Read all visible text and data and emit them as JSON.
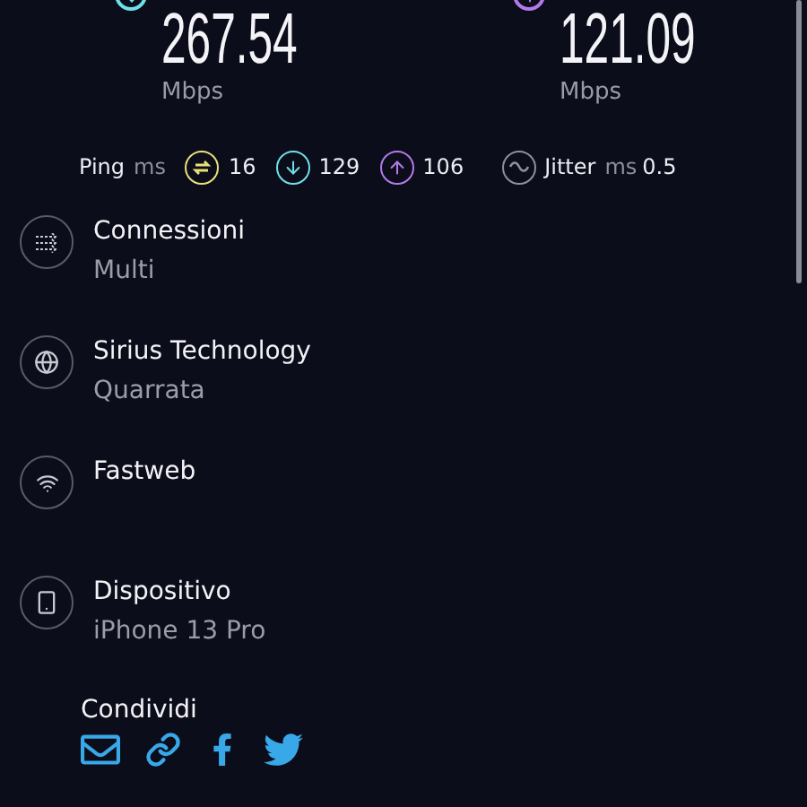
{
  "speeds": [
    {
      "kind": "download",
      "value": "267.54",
      "unit": "Mbps",
      "color": "#6fe0e8"
    },
    {
      "kind": "upload",
      "value": "121.09",
      "unit": "Mbps",
      "color": "#b47be8"
    }
  ],
  "ping": {
    "label": "Ping",
    "unit": "ms",
    "items": [
      {
        "kind": "idle",
        "value": "16",
        "color": "#e8e27a"
      },
      {
        "kind": "download",
        "value": "129",
        "color": "#6fe0e8"
      },
      {
        "kind": "upload",
        "value": "106",
        "color": "#b47be8"
      }
    ]
  },
  "jitter": {
    "label": "Jitter",
    "unit": "ms",
    "value": "0.5"
  },
  "details": [
    {
      "kind": "connections",
      "title": "Connessioni",
      "subtitle": "Multi"
    },
    {
      "kind": "server",
      "title": "Sirius Technology",
      "subtitle": "Quarrata"
    },
    {
      "kind": "provider",
      "title": "Fastweb"
    },
    {
      "kind": "device",
      "title": "Dispositivo",
      "subtitle": "iPhone 13 Pro"
    }
  ],
  "share": {
    "title": "Condividi",
    "items": [
      {
        "kind": "email"
      },
      {
        "kind": "link"
      },
      {
        "kind": "facebook"
      },
      {
        "kind": "twitter"
      }
    ]
  }
}
